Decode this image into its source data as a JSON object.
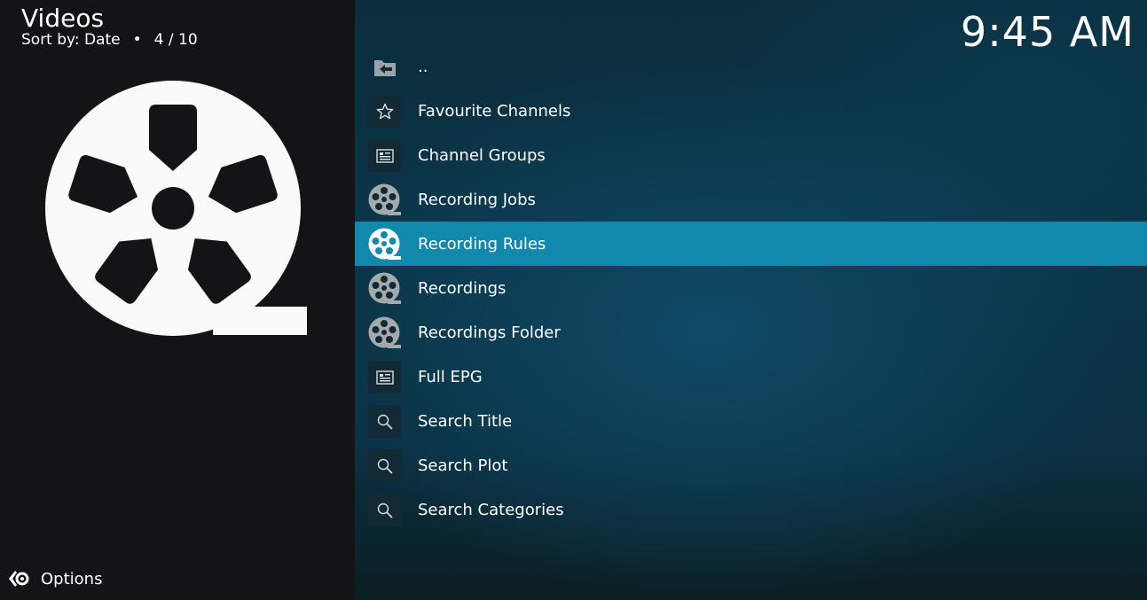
{
  "header": {
    "title": "Videos",
    "sort_label": "Sort by: Date",
    "separator": "•",
    "position": "4 / 10"
  },
  "clock": "9:45 AM",
  "footer": {
    "options_label": "Options"
  },
  "list": {
    "items": [
      {
        "label": "..",
        "icon": "folder-back-icon"
      },
      {
        "label": "Favourite Channels",
        "icon": "star-icon"
      },
      {
        "label": "Channel Groups",
        "icon": "epg-icon"
      },
      {
        "label": "Recording Jobs",
        "icon": "film-reel-icon"
      },
      {
        "label": "Recording Rules",
        "icon": "film-reel-icon",
        "selected": true
      },
      {
        "label": "Recordings",
        "icon": "film-reel-icon"
      },
      {
        "label": "Recordings Folder",
        "icon": "film-reel-icon"
      },
      {
        "label": "Full EPG",
        "icon": "epg-icon"
      },
      {
        "label": "Search Title",
        "icon": "search-icon"
      },
      {
        "label": "Search Plot",
        "icon": "search-icon"
      },
      {
        "label": "Search Categories",
        "icon": "search-icon"
      }
    ]
  },
  "colors": {
    "selected_row": "#1189ad",
    "icon_box": "#122a33",
    "left_panel": "#121416"
  }
}
